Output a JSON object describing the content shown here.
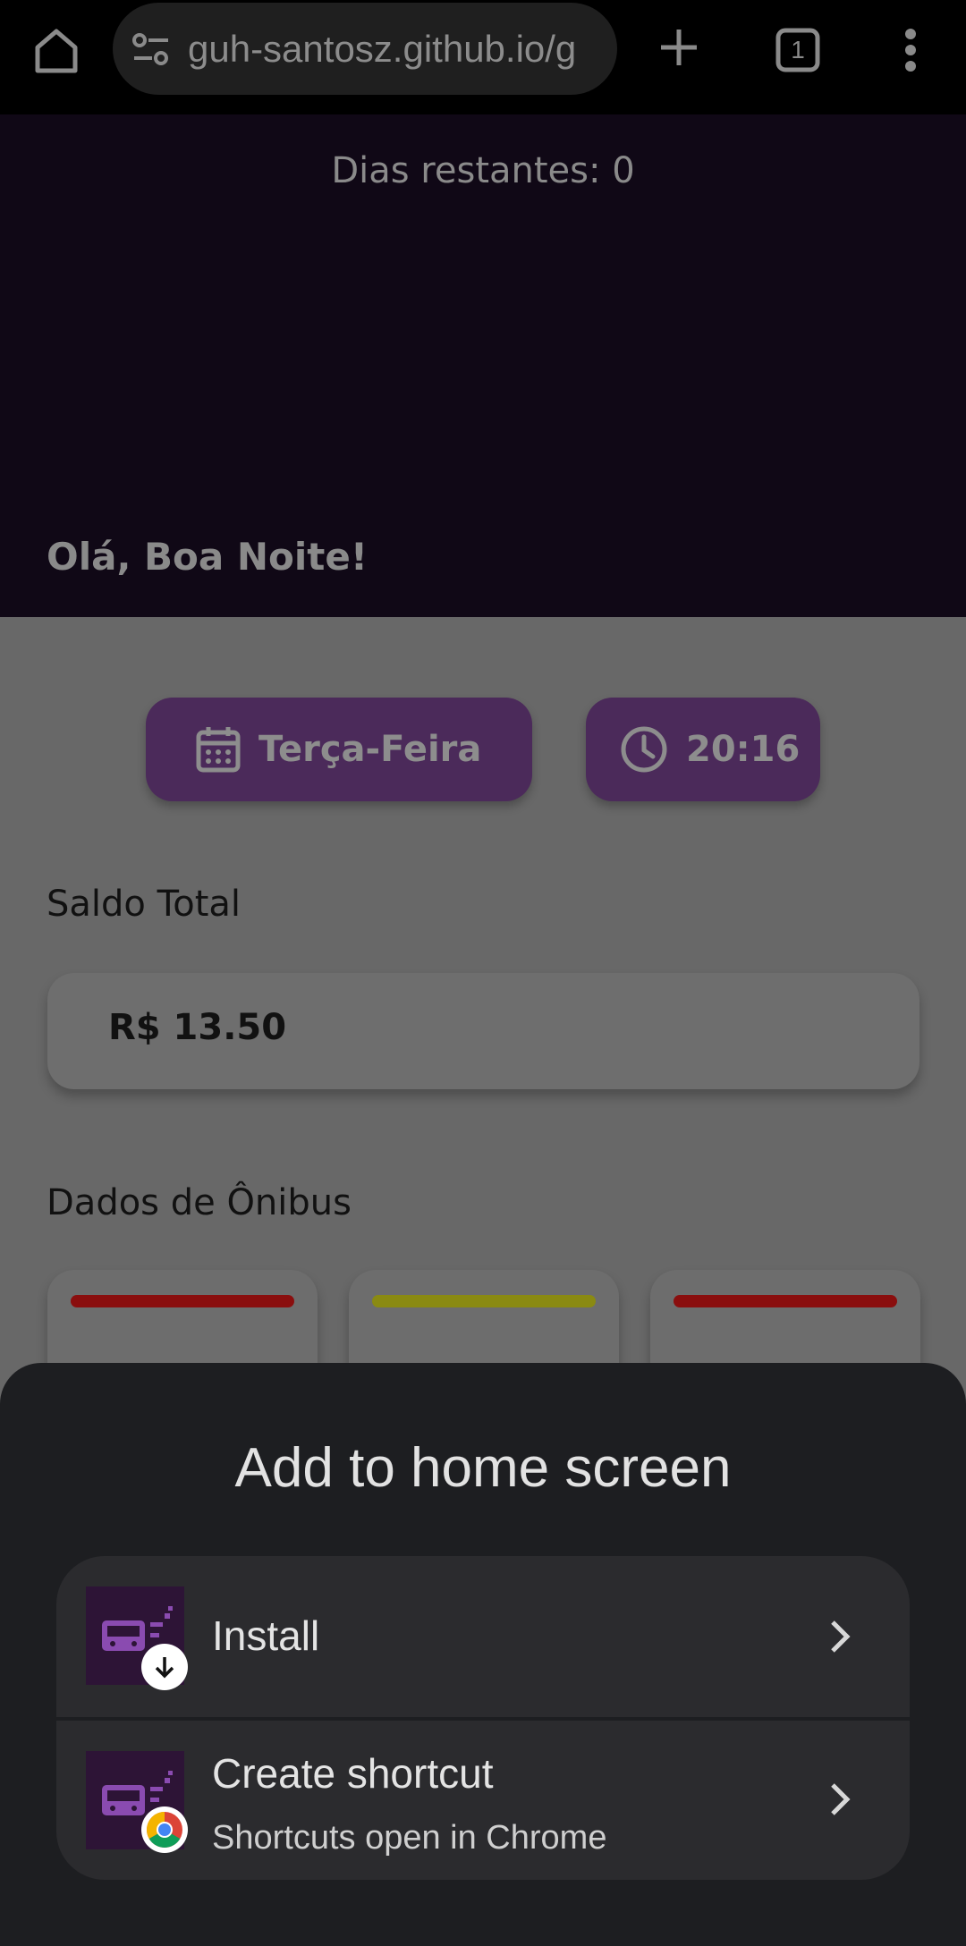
{
  "browser": {
    "url": "guh-santosz.github.io/g",
    "tab_count": "1",
    "icons": [
      "home-icon",
      "tune-icon",
      "plus-icon",
      "tabs-icon",
      "menu-icon"
    ]
  },
  "header": {
    "days_remaining": "Dias restantes: 0",
    "greeting": "Olá, Boa Noite!"
  },
  "info": {
    "day": "Terça-Feira",
    "time": "20:16"
  },
  "saldo": {
    "title": "Saldo Total",
    "value": "R$ 13.50"
  },
  "bus": {
    "title": "Dados de Ônibus",
    "cards": [
      {
        "status_color": "#8a0e0e"
      },
      {
        "status_color": "#8a8a12"
      },
      {
        "status_color": "#8a0e0e"
      }
    ]
  },
  "sheet": {
    "title": "Add to home screen",
    "install_label": "Install",
    "shortcut_label": "Create shortcut",
    "shortcut_sub": "Shortcuts open in Chrome"
  },
  "colors": {
    "header_bg": "#100816",
    "pill_bg": "#4b2a5a",
    "sheet_bg": "#1d1e21",
    "option_bg": "#2b2b2e"
  }
}
